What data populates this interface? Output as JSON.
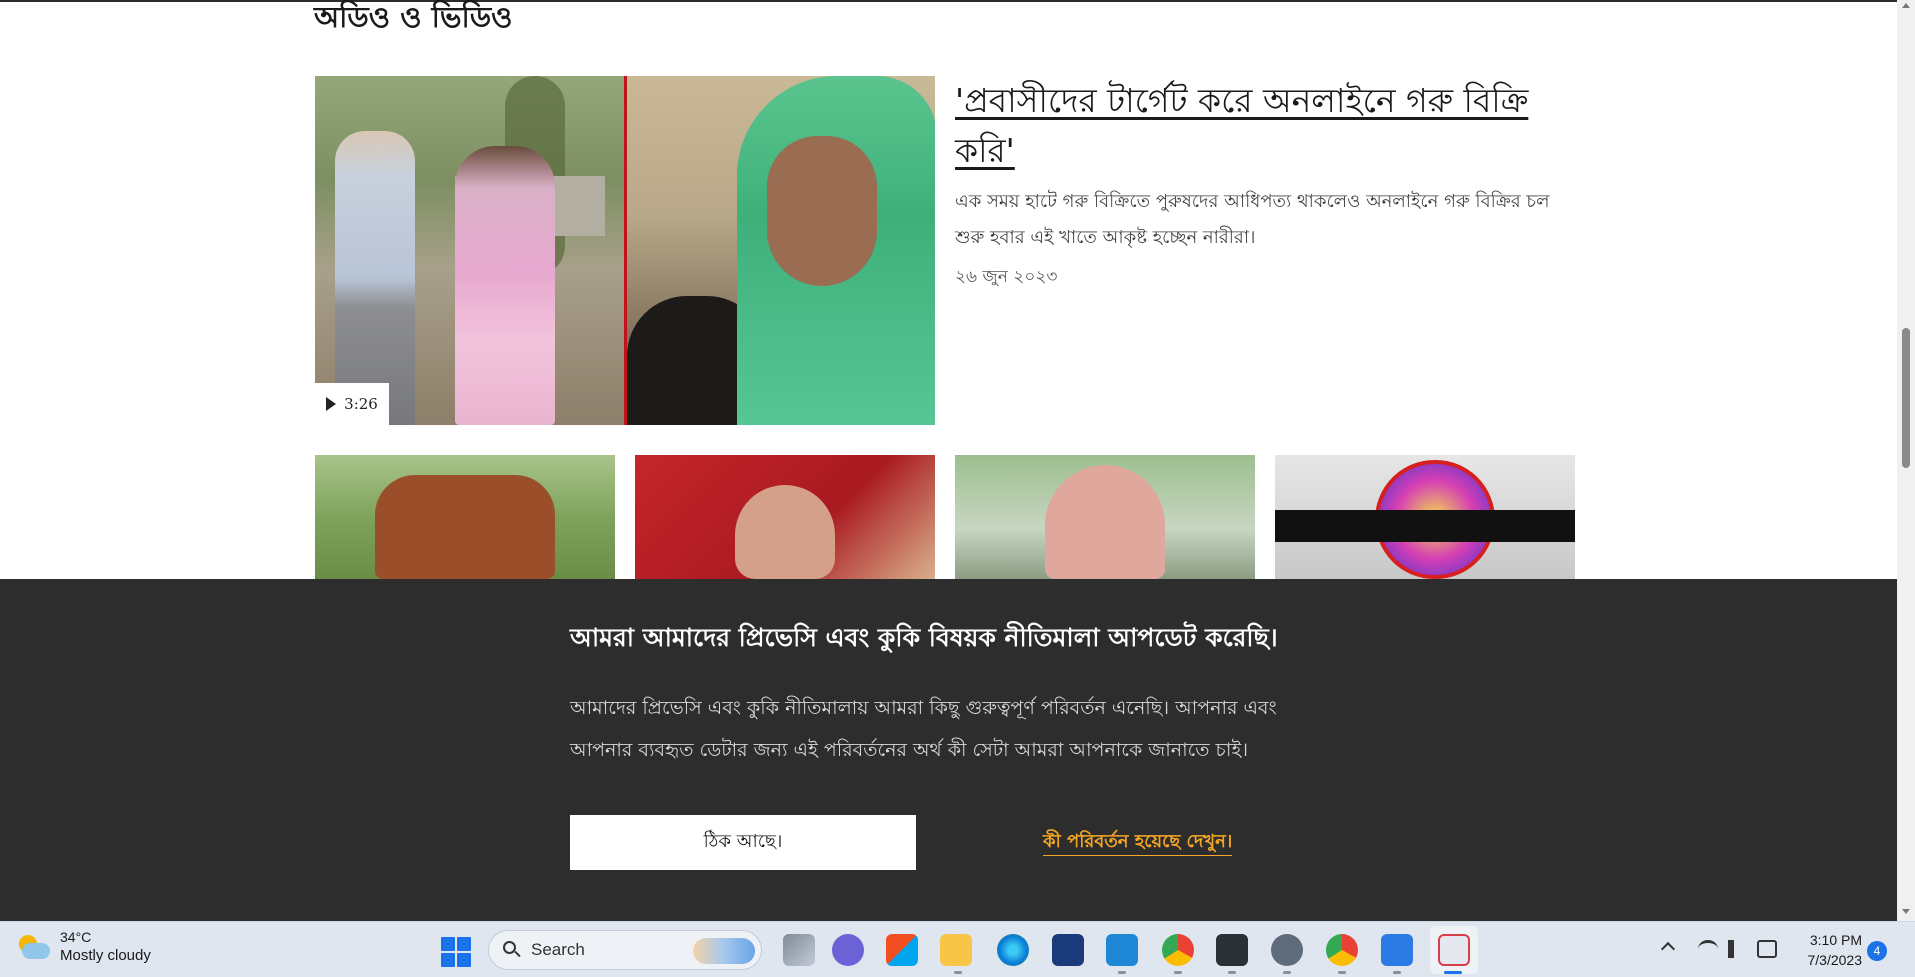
{
  "section": {
    "title": "অডিও ও ভিডিও"
  },
  "hero": {
    "title": "'প্রবাসীদের টার্গেট করে অনলাইনে গরু বিক্রি করি'",
    "summary": "এক সময় হাটে গরু বিক্রিতে পুরুষদের আধিপত্য থাকলেও অনলাইনে গরু বিক্রির চল শুরু হবার এই খাতে আকৃষ্ট হচ্ছেন নারীরা।",
    "date": "২৬ জুন ২০২৩",
    "duration": "3:26"
  },
  "cookie": {
    "title": "আমরা আমাদের প্রিভেসি এবং কুকি বিষয়ক নীতিমালা আপডেট করেছি।",
    "text": "আমাদের প্রিভেসি এবং কুকি নীতিমালায় আমরা কিছু গুরুত্বপূর্ণ পরিবর্তন এনেছি। আপনার এবং আপনার ব্যবহৃত ডেটার জন্য এই পরিবর্তনের অর্থ কী সেটা আমরা আপনাকে জানাতে চাই।",
    "ok_label": "ঠিক আছে।",
    "changes_label": "কী পরিবর্তন হয়েছে দেখুন।"
  },
  "taskbar": {
    "weather_temp": "34°C",
    "weather_desc": "Mostly cloudy",
    "search_label": "Search",
    "time": "3:10 PM",
    "date": "7/3/2023",
    "notifications": "4",
    "apps": [
      "task-view",
      "teams-chat",
      "microsoft-store",
      "file-explorer",
      "edge",
      "security",
      "vscode",
      "chrome",
      "terminal",
      "settings",
      "chrome-alt",
      "notepad",
      "snipping-tool"
    ]
  },
  "colors": {
    "banner_bg": "#2d2d2d",
    "link_accent": "#f5a623",
    "divider_red": "#c2121b",
    "taskbar_bg": "#dfe6ef"
  }
}
